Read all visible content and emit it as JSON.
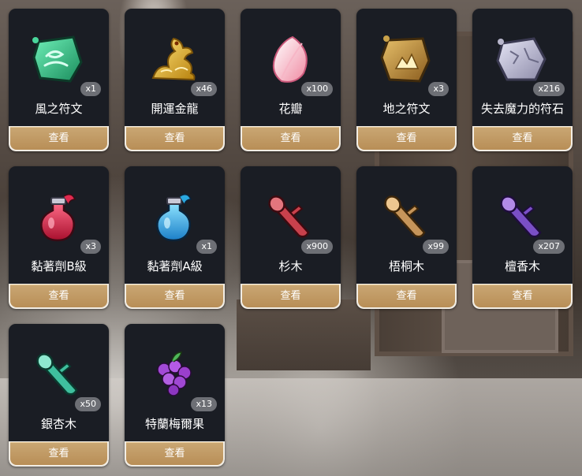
{
  "items": [
    {
      "name": "風之符文",
      "count": "x1",
      "action": "查看",
      "icon": "wind-rune-icon"
    },
    {
      "name": "開運金龍",
      "count": "x46",
      "action": "查看",
      "icon": "golden-dragon-icon"
    },
    {
      "name": "花瓣",
      "count": "x100",
      "action": "查看",
      "icon": "petal-icon"
    },
    {
      "name": "地之符文",
      "count": "x3",
      "action": "查看",
      "icon": "earth-rune-icon"
    },
    {
      "name": "失去魔力的符石",
      "count": "x216",
      "action": "查看",
      "icon": "depleted-runestone-icon"
    },
    {
      "name": "黏著劑B級",
      "count": "x3",
      "action": "查看",
      "icon": "adhesive-b-potion-icon"
    },
    {
      "name": "黏著劑A級",
      "count": "x1",
      "action": "查看",
      "icon": "adhesive-a-potion-icon"
    },
    {
      "name": "杉木",
      "count": "x900",
      "action": "查看",
      "icon": "cedar-log-icon"
    },
    {
      "name": "梧桐木",
      "count": "x99",
      "action": "查看",
      "icon": "sycamore-log-icon"
    },
    {
      "name": "檀香木",
      "count": "x207",
      "action": "查看",
      "icon": "sandalwood-log-icon"
    },
    {
      "name": "銀杏木",
      "count": "x50",
      "action": "查看",
      "icon": "ginkgo-log-icon"
    },
    {
      "name": "特蘭梅爾果",
      "count": "x13",
      "action": "查看",
      "icon": "berry-fruit-icon"
    }
  ]
}
